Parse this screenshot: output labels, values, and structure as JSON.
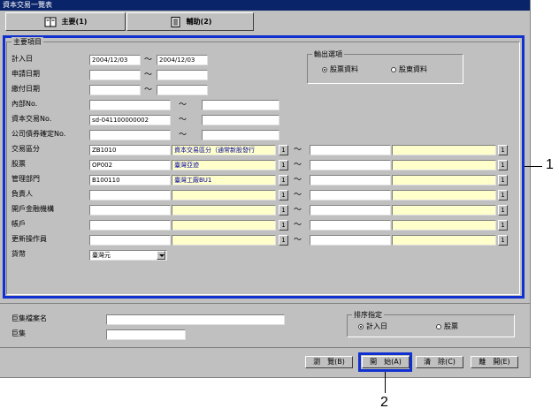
{
  "window": {
    "title": "資本交易一覽表"
  },
  "tabs": [
    {
      "label": "主要(1)"
    },
    {
      "label": "輔助(2)"
    }
  ],
  "main_group": {
    "title": "主要項目",
    "tilde": "～",
    "picker": "1",
    "rows": [
      {
        "label": "計入日",
        "from": "2004/12/03",
        "to": "2004/12/03"
      },
      {
        "label": "申請日期",
        "from": "",
        "to": ""
      },
      {
        "label": "繳付日期",
        "from": "",
        "to": ""
      },
      {
        "label": "內部No.",
        "from": "",
        "to": ""
      },
      {
        "label": "資本交易No.",
        "from": "sd-041100000002",
        "to": ""
      },
      {
        "label": "公司債券確定No.",
        "from": "",
        "to": ""
      },
      {
        "label": "交易區分",
        "from_code": "ZB1010",
        "from_name": "資本交易區分（通常新股發行",
        "to_code": "",
        "to_name": ""
      },
      {
        "label": "股票",
        "from_code": "OP002",
        "from_name": "臺灣亞迹",
        "to_code": "",
        "to_name": ""
      },
      {
        "label": "管理部門",
        "from_code": "B100110",
        "from_name": "臺灣工廠BU1",
        "to_code": "",
        "to_name": ""
      },
      {
        "label": "負責人",
        "from_code": "",
        "from_name": "",
        "to_code": "",
        "to_name": ""
      },
      {
        "label": "開戶金融機構",
        "from_code": "",
        "from_name": "",
        "to_code": "",
        "to_name": ""
      },
      {
        "label": "帳戶",
        "from_code": "",
        "from_name": "",
        "to_code": "",
        "to_name": ""
      },
      {
        "label": "更新操作員",
        "from_code": "",
        "from_name": "",
        "to_code": "",
        "to_name": ""
      }
    ],
    "currency": {
      "label": "貨幣",
      "value": "臺灣元"
    }
  },
  "output_group": {
    "title": "輸出選項",
    "options": [
      {
        "label": "股票資料",
        "selected": true
      },
      {
        "label": "股東資料",
        "selected": false
      }
    ]
  },
  "bottom": {
    "file_label": "巨集檔案名",
    "file_value": "",
    "macro_label": "巨集",
    "macro_value": ""
  },
  "sort_group": {
    "title": "排序指定",
    "options": [
      {
        "label": "計入日",
        "selected": true
      },
      {
        "label": "股票",
        "selected": false
      }
    ]
  },
  "buttons": {
    "browse": "瀏　覽(B)",
    "start": "開　始(A)",
    "clear": "清　除(C)",
    "close": "離　開(E)"
  },
  "callouts": {
    "one": "1",
    "two": "2"
  },
  "colors": {
    "highlight": "#1030d0",
    "title_bar": "#0a246a",
    "name_field": "#ffffcc"
  }
}
